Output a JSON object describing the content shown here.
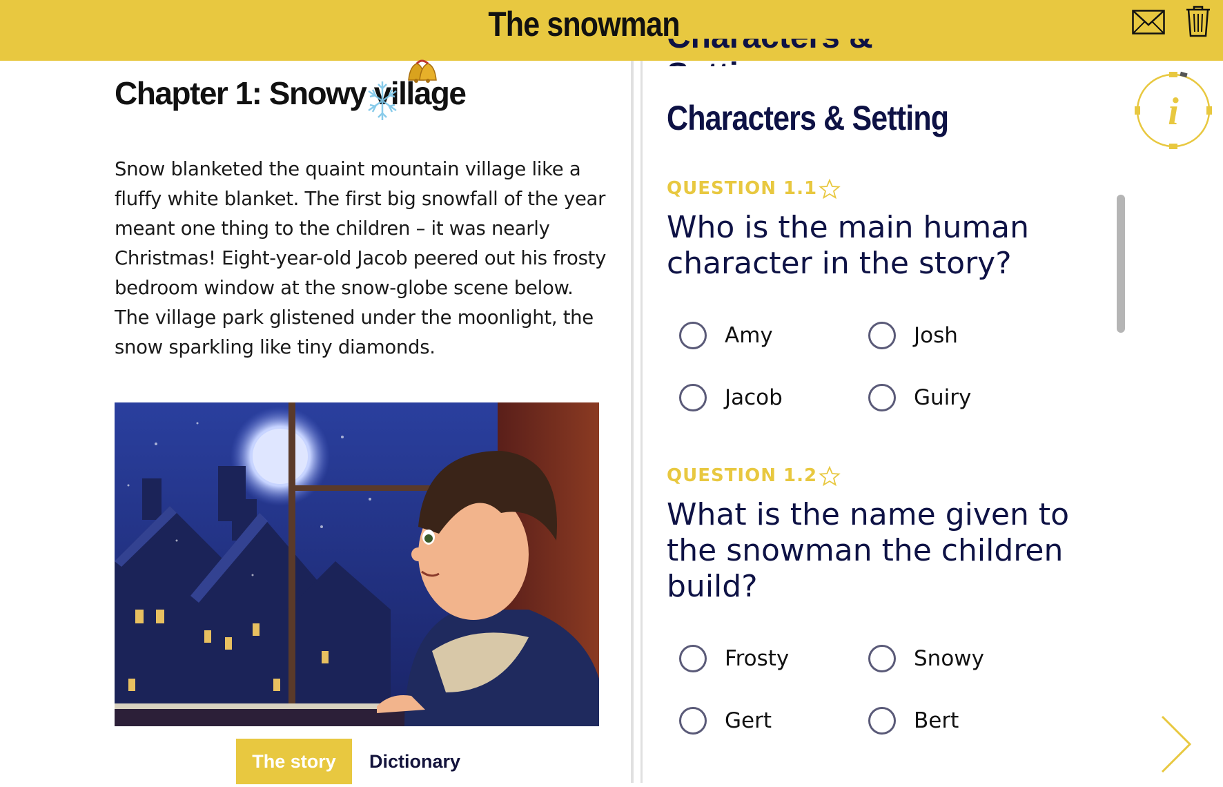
{
  "header": {
    "title": "The snowman",
    "mail_icon": "envelope-icon",
    "trash_icon": "trash-icon",
    "color": "#e8c840"
  },
  "story": {
    "chapter_title": "Chapter 1: Snowy village",
    "text": "Snow blanketed the quaint mountain village like a fluffy white blanket. The first big snowfall of the year meant one thing to the children – it was nearly Christmas! Eight-year-old Jacob peered out his frosty bedroom window at the snow-globe scene below. The village park glistened under the moonlight, the snow sparkling like tiny diamonds.",
    "tabs": [
      {
        "label": "The story",
        "active": true
      },
      {
        "label": "Dictionary",
        "active": false
      }
    ]
  },
  "quiz": {
    "section_title": "Characters & Setting",
    "questions": [
      {
        "label": "QUESTION 1.1",
        "text": "Who is the main human character in the story?",
        "options": [
          "Amy",
          "Josh",
          "Jacob",
          "Guiry"
        ]
      },
      {
        "label": "QUESTION 1.2",
        "text": "What is the name given to the snowman the children build?",
        "options": [
          "Frosty",
          "Snowy",
          "Gert",
          "Bert"
        ]
      }
    ]
  },
  "colors": {
    "accent": "#e8c840",
    "navy": "#0e1245"
  },
  "icons": [
    "envelope-icon",
    "trash-icon",
    "bells-icon",
    "snowflake-icon",
    "star-icon",
    "info-icon",
    "chevron-right-icon"
  ]
}
